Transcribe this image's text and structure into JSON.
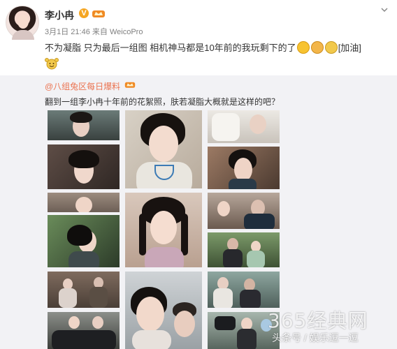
{
  "post": {
    "author": "李小冉",
    "time": "3月1日 21:46",
    "source_prefix": "来自",
    "source": "WeicoPro",
    "text_main": "不为凝脂 只为最后一组图 相机神马都是10年前的我玩剩下的了",
    "tag": "[加油]"
  },
  "repost": {
    "author": "@八组兔区每日爆料",
    "text": "翻到一组李小冉十年前的花絮照，肤若凝脂大概就是这样的吧？"
  },
  "watermark": {
    "main": "365经典网",
    "sub": "头条号 / 娱乐逗一逗"
  },
  "icons": {
    "vip": "vip-badge-icon",
    "member": "member-crown-icon",
    "menu": "chevron-down-icon"
  },
  "colors": {
    "repost_author": "#eb7350",
    "repost_bg": "#f2f2f5",
    "vip": "#f5a623"
  }
}
